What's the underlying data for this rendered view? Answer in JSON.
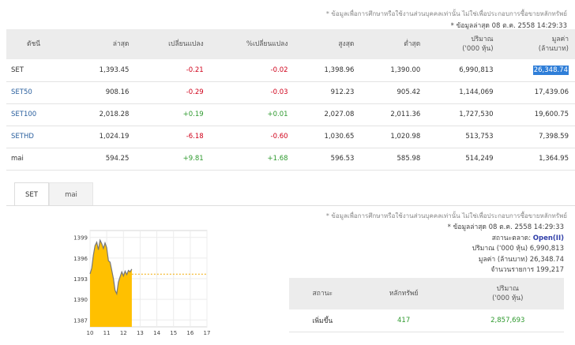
{
  "disclaimer": "* ข้อมูลเพื่อการศึกษาหรือใช้งานส่วนบุคคลเท่านั้น ไม่ใช่เพื่อประกอบการซื้อขายหลักทรัพย์",
  "as_of": "* ข้อมูลล่าสุด 08 ต.ค. 2558 14:29:33",
  "index_table": {
    "headers": [
      "ดัชนี",
      "ล่าสุด",
      "เปลี่ยนแปลง",
      "%เปลี่ยนแปลง",
      "สูงสุด",
      "ต่ำสุด",
      "ปริมาณ\n('000 หุ้น)",
      "มูลค่า\n(ล้านบาท)"
    ],
    "rows": [
      {
        "name": "SET",
        "last": "1,393.45",
        "chg": "-0.21",
        "pct": "-0.02",
        "high": "1,398.96",
        "low": "1,390.00",
        "vol": "6,990,813",
        "val": "26,348.74"
      },
      {
        "name": "SET50",
        "last": "908.16",
        "chg": "-0.29",
        "pct": "-0.03",
        "high": "912.23",
        "low": "905.42",
        "vol": "1,144,069",
        "val": "17,439.06"
      },
      {
        "name": "SET100",
        "last": "2,018.28",
        "chg": "+0.19",
        "pct": "+0.01",
        "high": "2,027.08",
        "low": "2,011.36",
        "vol": "1,727,530",
        "val": "19,600.75"
      },
      {
        "name": "SETHD",
        "last": "1,024.19",
        "chg": "-6.18",
        "pct": "-0.60",
        "high": "1,030.65",
        "low": "1,020.98",
        "vol": "513,753",
        "val": "7,398.59"
      },
      {
        "name": "mai",
        "last": "594.25",
        "chg": "+9.81",
        "pct": "+1.68",
        "high": "596.53",
        "low": "585.98",
        "vol": "514,249",
        "val": "1,364.95"
      }
    ]
  },
  "tabs": [
    "SET",
    "mai"
  ],
  "chart_data": {
    "type": "area",
    "y_ticks": [
      "1399",
      "1396",
      "1393",
      "1390",
      "1387"
    ],
    "x_ticks": [
      "10",
      "11",
      "12",
      "13",
      "14",
      "15",
      "16",
      "17"
    ],
    "ylim": [
      1386,
      1400
    ],
    "xlim": [
      10,
      17
    ],
    "reference_level": 1393.66,
    "x": [
      10.0,
      10.1,
      10.2,
      10.3,
      10.4,
      10.5,
      10.6,
      10.7,
      10.8,
      10.9,
      11.0,
      11.1,
      11.2,
      11.3,
      11.4,
      11.5,
      11.6,
      11.7,
      11.8,
      11.9,
      12.0,
      12.1,
      12.2,
      12.3,
      12.4,
      12.5
    ],
    "y": [
      1393.7,
      1394.5,
      1396.4,
      1397.8,
      1398.3,
      1397.2,
      1398.6,
      1398.1,
      1397.4,
      1398.2,
      1397.5,
      1395.6,
      1395.4,
      1394.2,
      1393.0,
      1391.3,
      1390.8,
      1392.5,
      1393.3,
      1394.0,
      1393.4,
      1394.1,
      1393.6,
      1394.2,
      1394.0,
      1394.4
    ]
  },
  "side_info": {
    "disclaimer": "* ข้อมูลเพื่อการศึกษาหรือใช้งานส่วนบุคคลเท่านั้น ไม่ใช่เพื่อประกอบการซื้อขายหลักทรัพย์",
    "as_of": "* ข้อมูลล่าสุด 08 ต.ค. 2558 14:29:33",
    "status_label": "สถานะตลาด:",
    "status_value": "Open(II)",
    "volume_label": "ปริมาณ ('000 หุ้น)",
    "volume_value": "6,990,813",
    "value_label": "มูลค่า (ล้านบาท)",
    "value_value": "26,348.74",
    "trades_label": "จำนวนรายการ",
    "trades_value": "199,217"
  },
  "market_table": {
    "headers": [
      "สถานะ",
      "หลักทรัพย์",
      "ปริมาณ\n('000 หุ้น)"
    ],
    "rows": [
      {
        "status": "เพิ่มขึ้น",
        "count": "417",
        "volume": "2,857,693"
      }
    ]
  },
  "colors": {
    "negative": "#d0021b",
    "positive": "#2f9a2f",
    "link": "#2a5f9e",
    "chart_fill": "#ffc000",
    "chart_line": "#777777",
    "status": "#2f3ea8"
  }
}
